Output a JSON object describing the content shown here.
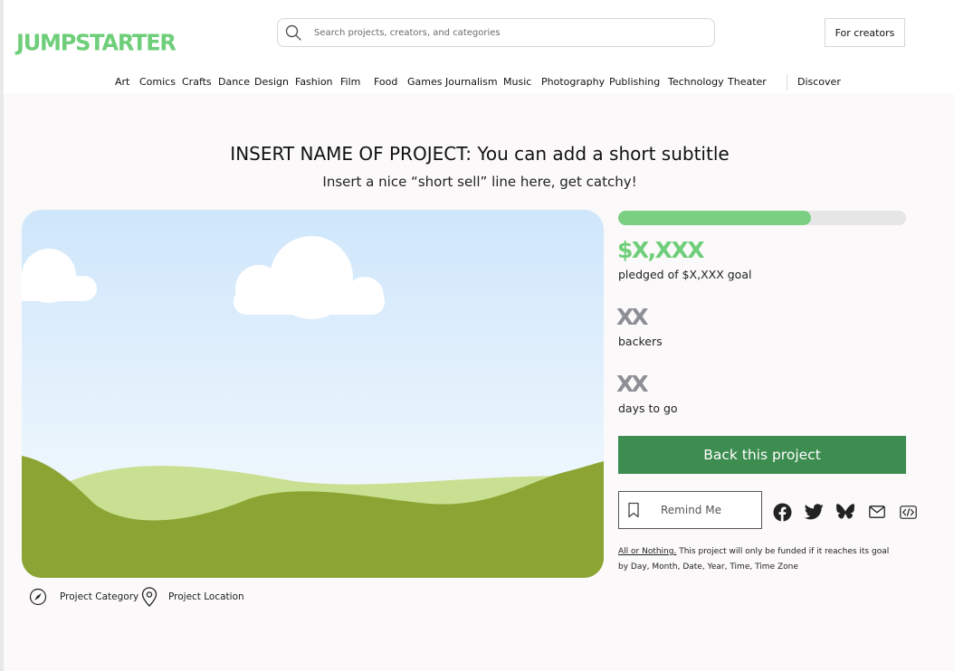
{
  "header": {
    "logo": "JUMPSTARTER",
    "search_placeholder": "Search projects, creators, and categories",
    "creators_button": "For creators"
  },
  "nav": {
    "categories": [
      "Art",
      "Comics",
      "Crafts",
      "Dance",
      "Design",
      "Fashion",
      "Film",
      "Food",
      "Games",
      "Journalism",
      "Music",
      "Photography",
      "Publishing",
      "Technology",
      "Theater"
    ],
    "discover": "Discover"
  },
  "project": {
    "title": "INSERT NAME OF PROJECT: You can add a short subtitle",
    "tagline": "Insert a nice “short sell” line here, get catchy!",
    "category": "Project Category",
    "location": "Project Location"
  },
  "stats": {
    "progress_fraction": 0.67,
    "pledged": "$X,XXX",
    "pledged_label": "pledged of $X,XXX goal",
    "backers": "XX",
    "backers_label": "backers",
    "days": "XX",
    "days_label": "days to go"
  },
  "actions": {
    "back_label": "Back this project",
    "remind_label": "Remind Me",
    "share_icons": [
      "facebook-icon",
      "twitter-icon",
      "bluesky-icon",
      "mail-icon",
      "embed-icon"
    ]
  },
  "notice": {
    "link_text": "All or Nothing.",
    "text": " This project will only be funded if it reaches its goal by Day, Month, Date, Year, Time, Time Zone"
  },
  "colors": {
    "brand_green": "#6fce7a",
    "button_green": "#3d8c50",
    "progress_green": "#7bcf83",
    "stat_gray": "#8e8e96"
  }
}
